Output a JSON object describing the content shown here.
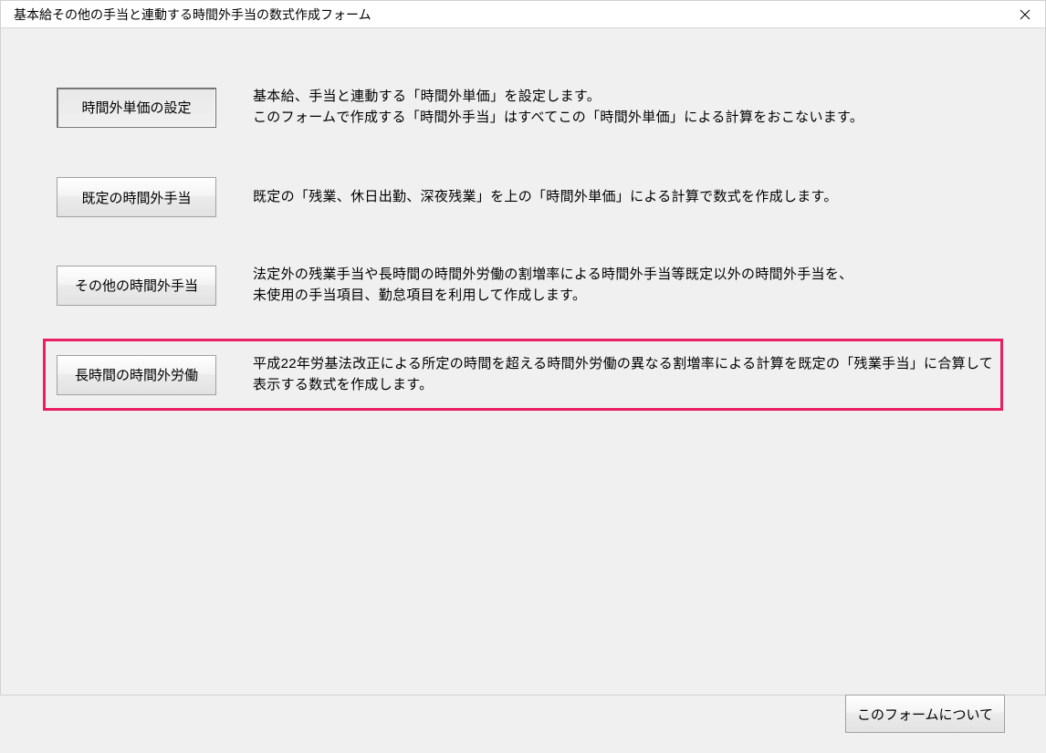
{
  "window": {
    "title": "基本給その他の手当と連動する時間外手当の数式作成フォーム"
  },
  "rows": [
    {
      "button_label": "時間外単価の設定",
      "description": "基本給、手当と連動する「時間外単価」を設定します。\nこのフォームで作成する「時間外手当」はすべてこの「時間外単価」による計算をおこないます。"
    },
    {
      "button_label": "既定の時間外手当",
      "description": "既定の「残業、休日出勤、深夜残業」を上の「時間外単価」による計算で数式を作成します。"
    },
    {
      "button_label": "その他の時間外手当",
      "description": "法定外の残業手当や長時間の時間外労働の割増率による時間外手当等既定以外の時間外手当を、\n未使用の手当項目、勤怠項目を利用して作成します。"
    },
    {
      "button_label": "長時間の時間外労働",
      "description": "平成22年労基法改正による所定の時間を超える時間外労働の異なる割増率による計算を既定の「残業手当」に合算して表示する数式を作成します。"
    }
  ],
  "footer": {
    "about_label": "このフォームについて"
  }
}
